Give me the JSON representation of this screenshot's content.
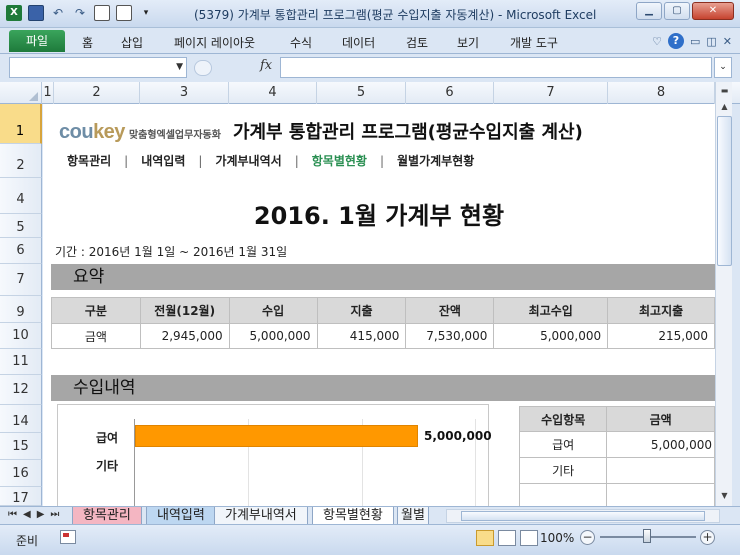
{
  "window": {
    "title": "(5379) 가계부 통합관리 프로그램(평균 수입지출 자동계산)  -  Microsoft Excel",
    "qat_icons": [
      "excel-logo-icon",
      "save-icon",
      "undo-icon",
      "redo-icon",
      "form-icon",
      "camera-icon",
      "customize-qat-icon"
    ],
    "excel_logo": "X"
  },
  "ribbon": {
    "file_tab": "파일",
    "tabs": [
      "홈",
      "삽입",
      "페이지 레이아웃",
      "수식",
      "데이터",
      "검토",
      "보기",
      "개발 도구"
    ]
  },
  "formula_bar": {
    "name_box": "",
    "fx_label": "fx",
    "formula": ""
  },
  "grid": {
    "columns": [
      "1",
      "2",
      "3",
      "4",
      "5",
      "6",
      "7",
      "8"
    ],
    "rows": [
      "1",
      "2",
      "4",
      "5",
      "6",
      "7",
      "9",
      "10",
      "11",
      "12",
      "14",
      "15",
      "16",
      "17"
    ]
  },
  "sheet": {
    "logo_main": "cou",
    "logo_accent": "key",
    "brand_sub": "맞춤형엑셀업무자동화",
    "app_title": "가계부 통합관리 프로그램(평균수입지출 계산)",
    "nav": [
      "항목관리",
      "내역입력",
      "가계부내역서",
      "항목별현황",
      "월별가계부현황"
    ],
    "nav_separator": "|",
    "report_title": "2016. 1월 가계부 현황",
    "period": "기간 : 2016년 1월 1일 ~ 2016년 1월 31일",
    "summary_section": "요약",
    "summary_headers": [
      "구분",
      "전월(12월)",
      "수입",
      "지출",
      "잔액",
      "최고수입",
      "최고지출"
    ],
    "summary_row": [
      "금액",
      "2,945,000",
      "5,000,000",
      "415,000",
      "7,530,000",
      "5,000,000",
      "215,000"
    ],
    "income_section": "수입내역",
    "income_table": {
      "headers": [
        "수입항목",
        "금액"
      ],
      "rows": [
        {
          "name": "급여",
          "amount": "5,000,000"
        },
        {
          "name": "기타",
          "amount": ""
        },
        {
          "name": "",
          "amount": ""
        }
      ]
    }
  },
  "chart_data": {
    "type": "bar",
    "orientation": "horizontal",
    "categories": [
      "급여",
      "기타"
    ],
    "values": [
      5000000,
      0
    ],
    "data_labels": [
      "5,000,000",
      ""
    ],
    "bar_color": "#ff9800",
    "title": "",
    "xlabel": "",
    "ylabel": "",
    "xlim": [
      0,
      6000000
    ]
  },
  "sheet_tabs": {
    "tabs": [
      "항목관리",
      "내역입력",
      "가계부내역서",
      "항목별현황",
      "월별"
    ],
    "active": "항목별현황"
  },
  "status_bar": {
    "ready": "준비",
    "zoom": "100%",
    "zoom_minus": "−",
    "zoom_plus": "+"
  }
}
